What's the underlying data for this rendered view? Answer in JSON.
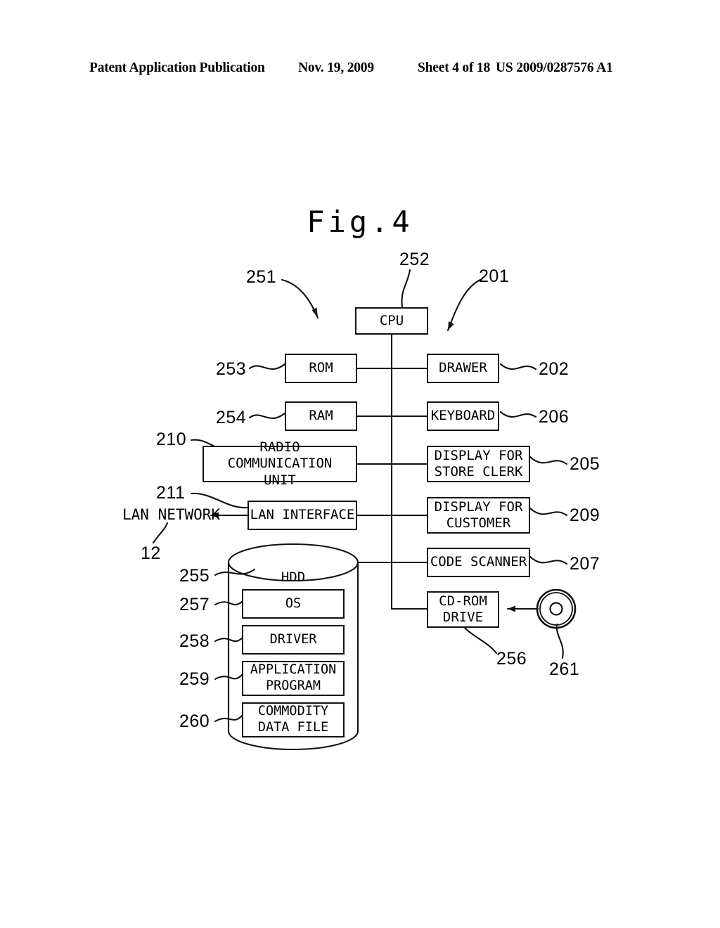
{
  "header": {
    "publication": "Patent Application Publication",
    "date": "Nov. 19, 2009",
    "sheet": "Sheet 4 of 18",
    "number": "US 2009/0287576 A1"
  },
  "figure": {
    "title": "Fig.4",
    "caption_label": "Fig.4"
  },
  "nodes": {
    "cpu": "CPU",
    "rom": "ROM",
    "ram": "RAM",
    "radio_communication_unit": "RADIO COMMUNICATION\nUNIT",
    "lan_interface": "LAN INTERFACE",
    "drawer": "DRAWER",
    "keyboard": "KEYBOARD",
    "display_store_clerk": "DISPLAY FOR\nSTORE CLERK",
    "display_customer": "DISPLAY FOR\nCUSTOMER",
    "code_scanner": "CODE SCANNER",
    "cd_rom_drive": "CD-ROM\nDRIVE",
    "hdd": "HDD",
    "os": "OS",
    "driver": "DRIVER",
    "application_program": "APPLICATION\nPROGRAM",
    "commodity_data_file": "COMMODITY\nDATA FILE"
  },
  "labels": {
    "lan_network": "LAN NETWORK"
  },
  "refs": {
    "r201": "201",
    "r202": "202",
    "r205": "205",
    "r206": "206",
    "r207": "207",
    "r209": "209",
    "r210": "210",
    "r211": "211",
    "r12": "12",
    "r251": "251",
    "r252": "252",
    "r253": "253",
    "r254": "254",
    "r255": "255",
    "r256": "256",
    "r257": "257",
    "r258": "258",
    "r259": "259",
    "r260": "260",
    "r261": "261"
  },
  "icons": {
    "cd_disc": "cd-disc-icon",
    "hdd_cylinder": "cylinder-icon"
  },
  "colors": {
    "ink": "#111111",
    "paper": "#ffffff"
  }
}
